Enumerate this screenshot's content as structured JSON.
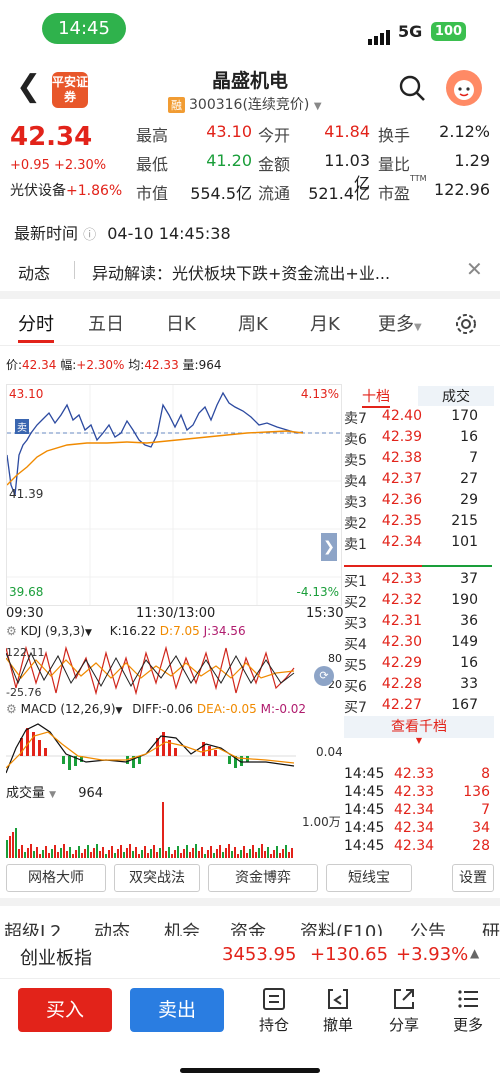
{
  "status": {
    "time": "14:45",
    "network": "5G",
    "battery": "100"
  },
  "header": {
    "broker_logo": "平安证券",
    "title": "晶盛机电",
    "badge": "融",
    "code": "300316(连续竞价)"
  },
  "quote": {
    "price": "42.34",
    "change": "+0.95 +2.30%",
    "sector": "光伏设备",
    "sector_change": "+1.86%",
    "rows": [
      {
        "l1": "最高",
        "v1": "43.10",
        "l2": "今开",
        "v2": "41.84",
        "l3": "换手",
        "v3": "2.12%"
      },
      {
        "l1": "最低",
        "v1": "41.20",
        "l2": "金额",
        "v2": "11.03亿",
        "l3": "量比",
        "v3": "1.29"
      },
      {
        "l1": "市值",
        "v1": "554.5亿",
        "l2": "流通",
        "v2": "521.4亿",
        "l3": "市盈",
        "l3sup": "TTM",
        "v3": "122.96"
      }
    ]
  },
  "latest": {
    "label": "最新时间",
    "value": "04-10 14:45:38"
  },
  "news": {
    "tag": "动态",
    "text": "异动解读：光伏板块下跌+资金流出+业..."
  },
  "tabs": [
    "分时",
    "五日",
    "日K",
    "周K",
    "月K",
    "更多"
  ],
  "pricebar": {
    "price_label": "价:",
    "price": "42.34",
    "amp_label": "幅:",
    "amp": "+2.30%",
    "avg_label": "均:",
    "avg": "42.33",
    "vol_label": "量:",
    "vol": "964"
  },
  "chart": {
    "high": "43.10",
    "low": "39.68",
    "high_pct": "4.13%",
    "low_pct": "-4.13%",
    "mid_label": "41.39",
    "sell_tag": "卖",
    "t_start": "09:30",
    "t_mid": "11:30/13:00",
    "t_end": "15:30"
  },
  "kdj": {
    "name": "KDJ (9,3,3)",
    "k": "K:16.22",
    "d": "D:7.05",
    "j": "J:34.56",
    "top": "122.11",
    "bottom": "-25.76",
    "r80": "80",
    "r20": "20"
  },
  "macd": {
    "name": "MACD (12,26,9)",
    "diff": "DIFF:-0.06",
    "dea": "DEA:-0.05",
    "m": "M:-0.02",
    "right": "0.04"
  },
  "volume": {
    "name": "成交量",
    "value": "964",
    "right": "1.00万"
  },
  "orderbook": {
    "header_left": "十档",
    "header_right": "成交",
    "more": "查看千档",
    "asks": [
      {
        "l": "卖7",
        "p": "42.40",
        "v": "170"
      },
      {
        "l": "卖6",
        "p": "42.39",
        "v": "16"
      },
      {
        "l": "卖5",
        "p": "42.38",
        "v": "7"
      },
      {
        "l": "卖4",
        "p": "42.37",
        "v": "27"
      },
      {
        "l": "卖3",
        "p": "42.36",
        "v": "29"
      },
      {
        "l": "卖2",
        "p": "42.35",
        "v": "215"
      },
      {
        "l": "卖1",
        "p": "42.34",
        "v": "101"
      }
    ],
    "bids": [
      {
        "l": "买1",
        "p": "42.33",
        "v": "37"
      },
      {
        "l": "买2",
        "p": "42.32",
        "v": "190"
      },
      {
        "l": "买3",
        "p": "42.31",
        "v": "36"
      },
      {
        "l": "买4",
        "p": "42.30",
        "v": "149"
      },
      {
        "l": "买5",
        "p": "42.29",
        "v": "16"
      },
      {
        "l": "买6",
        "p": "42.28",
        "v": "33"
      },
      {
        "l": "买7",
        "p": "42.27",
        "v": "167"
      }
    ],
    "trades": [
      {
        "t": "14:45",
        "p": "42.33",
        "v": "8"
      },
      {
        "t": "14:45",
        "p": "42.33",
        "v": "136"
      },
      {
        "t": "14:45",
        "p": "42.34",
        "v": "7"
      },
      {
        "t": "14:45",
        "p": "42.34",
        "v": "34"
      },
      {
        "t": "14:45",
        "p": "42.34",
        "v": "28"
      }
    ]
  },
  "tools": [
    "网格大师",
    "双突战法",
    "资金博弈",
    "短线宝",
    "设置"
  ],
  "subtabs": [
    "超级L2",
    "动态",
    "机会",
    "资金",
    "资料(F10)",
    "公告",
    "研"
  ],
  "index": {
    "name": "创业板指",
    "value": "3453.95",
    "change": "+130.65",
    "pct": "+3.93%"
  },
  "footer": {
    "buy": "买入",
    "sell": "卖出",
    "items": [
      "持仓",
      "撤单",
      "分享",
      "更多"
    ]
  }
}
